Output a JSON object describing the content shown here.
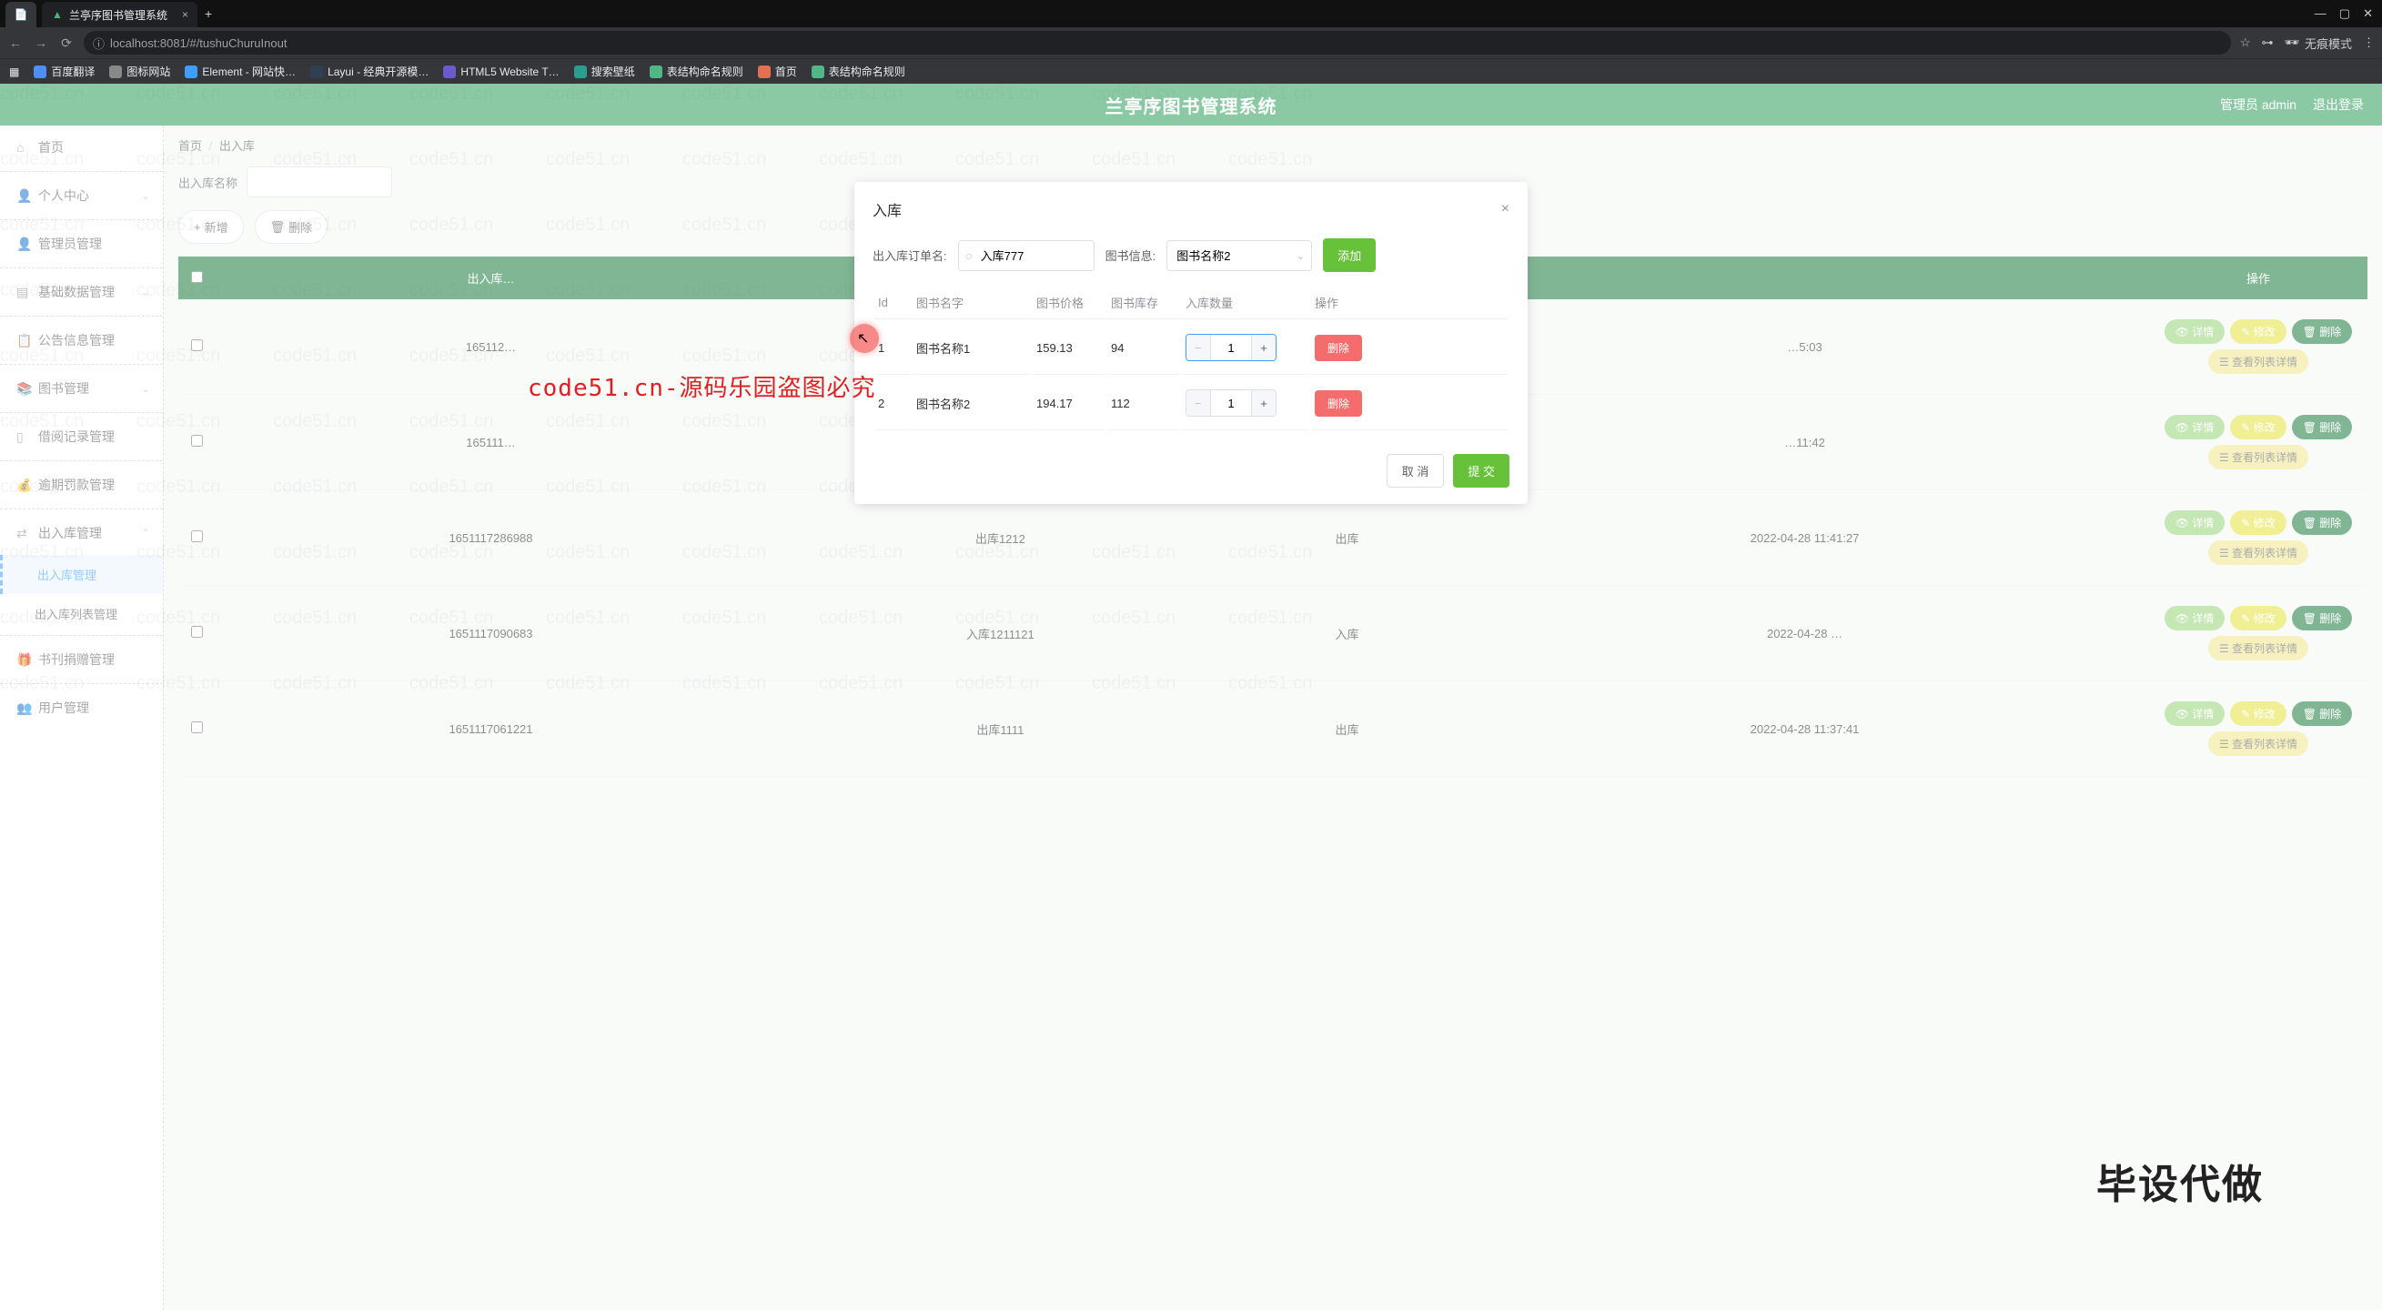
{
  "browser": {
    "tabs": [
      {
        "label": "兰亭序图书管理系统"
      }
    ],
    "url": "localhost:8081/#/tushuChuruInout",
    "incognito_label": "无痕模式",
    "bookmarks": [
      "百度翻译",
      "图标网站",
      "Element - 网站快…",
      "Layui - 经典开源模…",
      "HTML5 Website T…",
      "搜索壁纸",
      "表结构命名规则",
      "首页",
      "表结构命名规则"
    ]
  },
  "header": {
    "title": "兰亭序图书管理系统",
    "user_label": "管理员 admin",
    "logout_label": "退出登录"
  },
  "sidebar": {
    "items": [
      {
        "icon": "home",
        "label": "首页"
      },
      {
        "icon": "user",
        "label": "个人中心",
        "expandable": true
      },
      {
        "icon": "user",
        "label": "管理员管理"
      },
      {
        "icon": "data",
        "label": "基础数据管理",
        "expandable": true
      },
      {
        "icon": "bell",
        "label": "公告信息管理"
      },
      {
        "icon": "book",
        "label": "图书管理",
        "expandable": true
      },
      {
        "icon": "doc",
        "label": "借阅记录管理"
      },
      {
        "icon": "money",
        "label": "逾期罚款管理"
      },
      {
        "icon": "inout",
        "label": "出入库管理",
        "expanded": true
      },
      {
        "sub": true,
        "label": "出入库管理",
        "active": true
      },
      {
        "sub": true,
        "label": "出入库列表管理"
      },
      {
        "icon": "gift",
        "label": "书刊捐赠管理"
      },
      {
        "icon": "users",
        "label": "用户管理"
      }
    ]
  },
  "breadcrumb": {
    "home": "首页",
    "current": "出入库"
  },
  "filters": {
    "label": "出入库名称"
  },
  "actions": {
    "add_label": "新增",
    "delete_label": "删除"
  },
  "bg_table": {
    "headers": [
      "",
      "出入库…",
      "…",
      "…",
      "…",
      "操作"
    ],
    "rows": [
      {
        "id": "165112…",
        "name": "…",
        "type": "…",
        "time": "…5:03"
      },
      {
        "id": "165111…",
        "name": "…",
        "type": "…",
        "time": "…11:42"
      },
      {
        "id": "1651117286988",
        "name": "出库1212",
        "type": "出库",
        "time": "2022-04-28  11:41:27"
      },
      {
        "id": "1651117090683",
        "name": "入库1211121",
        "type": "入库",
        "time": "2022-04-28  …"
      },
      {
        "id": "1651117061221",
        "name": "出库1111",
        "type": "出库",
        "time": "2022-04-28  11:37:41"
      }
    ],
    "action_labels": {
      "view": "详情",
      "edit": "修改",
      "delete": "删除",
      "list_detail": "查看列表详情"
    }
  },
  "dialog": {
    "title": "入库",
    "order_label": "出入库订单名:",
    "order_value": "入库777",
    "book_label": "图书信息:",
    "book_selected": "图书名称2",
    "add_button": "添加",
    "cancel_button": "取 消",
    "submit_button": "提 交",
    "table": {
      "headers": {
        "id": "Id",
        "name": "图书名字",
        "price": "图书价格",
        "stock": "图书库存",
        "qty": "入库数量",
        "op": "操作"
      },
      "rows": [
        {
          "id": "1",
          "name": "图书名称1",
          "price": "159.13",
          "stock": "94",
          "qty": "1",
          "active": true
        },
        {
          "id": "2",
          "name": "图书名称2",
          "price": "194.17",
          "stock": "112",
          "qty": "1",
          "active": false
        }
      ],
      "delete_label": "删除"
    }
  },
  "watermark": {
    "text": "code51.cn",
    "center": "code51.cn-源码乐园盗图必究",
    "corner": "毕设代做"
  }
}
